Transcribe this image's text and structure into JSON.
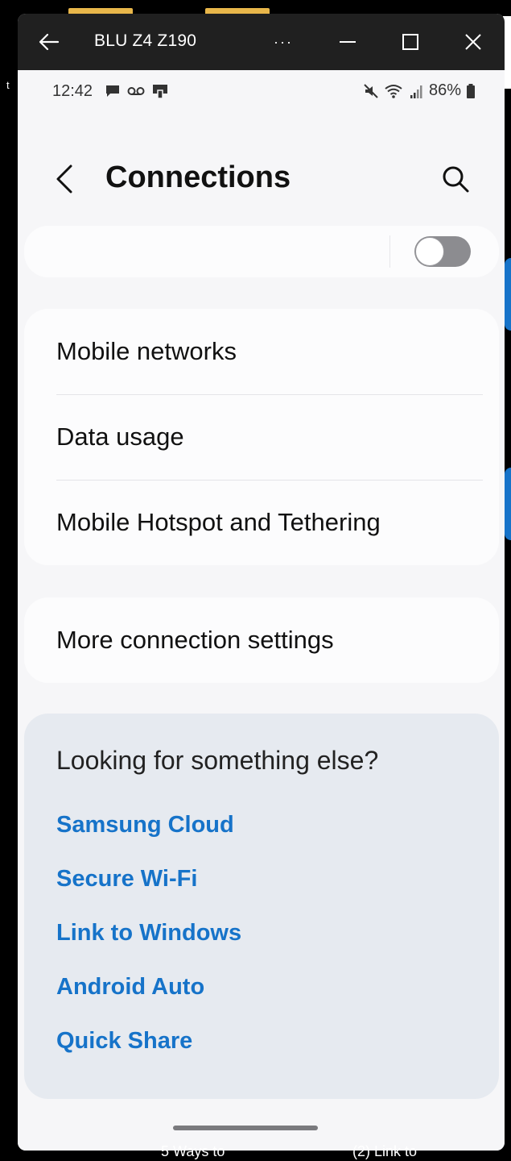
{
  "window": {
    "title": "BLU Z4 Z190",
    "more_label": "···"
  },
  "statusbar": {
    "time": "12:42",
    "battery": "86%"
  },
  "header": {
    "title": "Connections"
  },
  "connections": {
    "items": [
      {
        "label": "Mobile networks"
      },
      {
        "label": "Data usage"
      },
      {
        "label": "Mobile Hotspot and Tethering"
      }
    ],
    "more_label": "More connection settings",
    "toggle_on": false
  },
  "looking": {
    "title": "Looking for something else?",
    "links": [
      {
        "label": "Samsung Cloud"
      },
      {
        "label": "Secure Wi-Fi"
      },
      {
        "label": "Link to Windows"
      },
      {
        "label": "Android Auto"
      },
      {
        "label": "Quick Share"
      }
    ]
  },
  "background": {
    "left_glyph": "t",
    "peek_left": "5 Ways to",
    "peek_right": "(2) Link to"
  },
  "colors": {
    "link": "#1673c9",
    "titlebar": "#202020",
    "screen_bg": "#f6f6f8"
  }
}
